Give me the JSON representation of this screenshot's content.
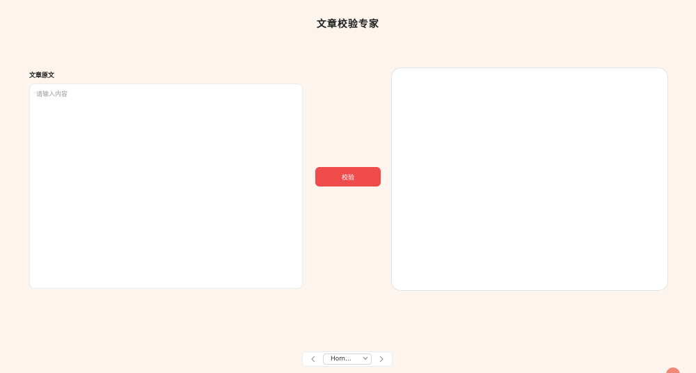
{
  "header": {
    "title": "文章校验专家"
  },
  "form": {
    "label": "文章原文",
    "placeholder": "请输入内容",
    "value": ""
  },
  "actions": {
    "check_label": "校验"
  },
  "result": {
    "text": ""
  },
  "pager": {
    "selected": "Hom..."
  },
  "colors": {
    "background": "#fdf5ed",
    "accent": "#ef4b4b",
    "panel": "#ffffff",
    "avatar": "#f08a78"
  },
  "icons": {
    "prev": "chevron-left-icon",
    "next": "chevron-right-icon",
    "dropdown": "chevron-down-icon"
  }
}
